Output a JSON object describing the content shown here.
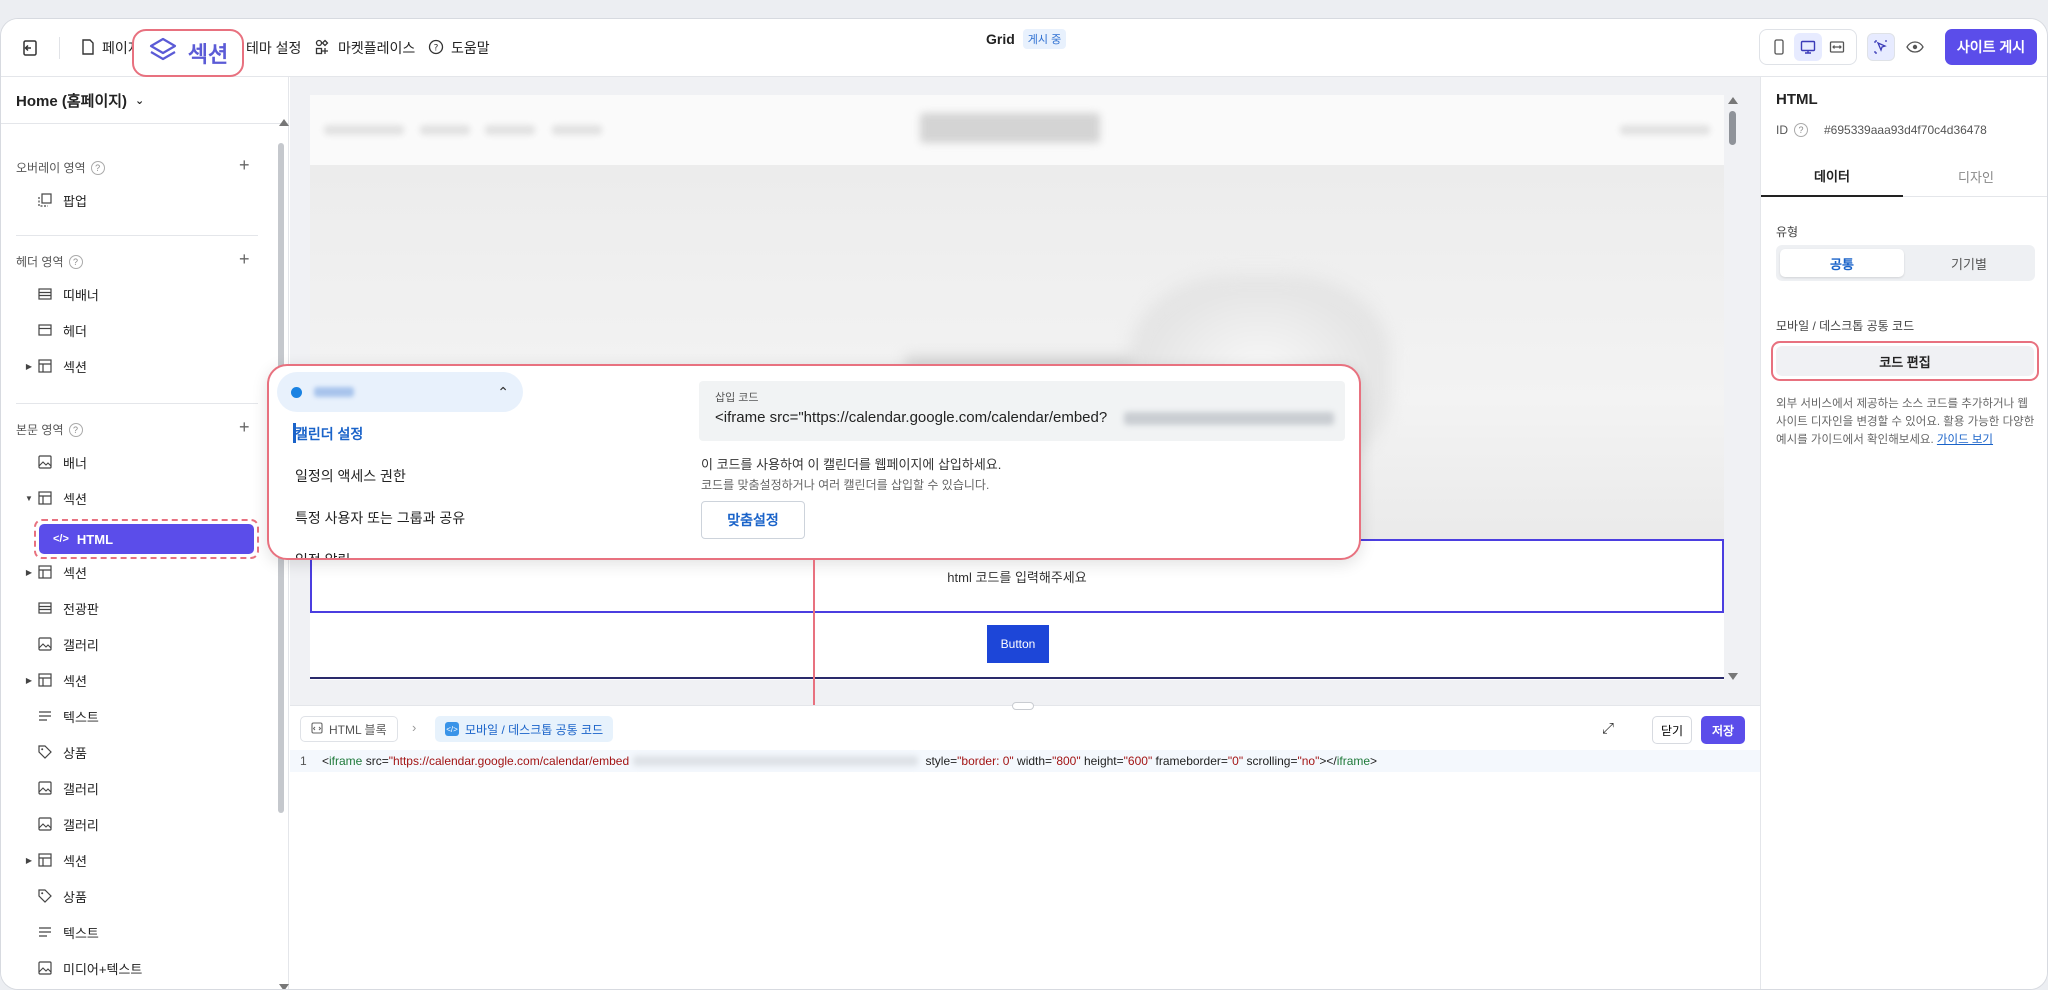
{
  "topbar": {
    "page_label": "페이지",
    "section_label": "섹션",
    "theme_label": "테마 설정",
    "marketplace_label": "마켓플레이스",
    "help_label": "도움말",
    "title": "Grid",
    "status_badge": "게시 중",
    "publish_label": "사이트 게시"
  },
  "left": {
    "page_selector": "Home (홈페이지)",
    "groups": {
      "overlay": "오버레이 영역",
      "header": "헤더 영역",
      "body": "본문 영역"
    },
    "items": {
      "popup": "팝업",
      "ddibanner": "띠배너",
      "header": "헤더",
      "section1": "섹션",
      "banner": "배너",
      "section2": "섹션",
      "html": "HTML",
      "section3": "섹션",
      "billboard": "전광판",
      "gallery1": "갤러리",
      "section4": "섹션",
      "text1": "텍스트",
      "product1": "상품",
      "gallery2": "갤러리",
      "gallery3": "갤러리",
      "section5": "섹션",
      "product2": "상품",
      "text2": "텍스트",
      "mediatext": "미디어+텍스트"
    }
  },
  "canvas": {
    "html_placeholder": "html 코드를 입력해주세요",
    "button_label": "Button"
  },
  "callout": {
    "menu": {
      "calendar_settings": "캘린더 설정",
      "access": "일정의 액세스 권한",
      "share": "특정 사용자 또는 그룹과 공유",
      "partial": "일정 알림"
    },
    "embed_label": "삽입 코드",
    "embed_code": "<iframe src=\"https://calendar.google.com/calendar/embed?",
    "desc1": "이 코드를 사용하여 이 캘린더를 웹페이지에 삽입하세요.",
    "desc2": "코드를 맞춤설정하거나 여러 캘린더를 삽입할 수 있습니다.",
    "custom_button": "맞춤설정"
  },
  "editor": {
    "crumb1": "HTML 블록",
    "crumb_sep": "›",
    "crumb2": "모바일 / 데스크톱 공통 코드",
    "close_label": "닫기",
    "save_label": "저장",
    "line_number": "1",
    "code": {
      "open_lt": "<",
      "tag": "iframe",
      "src_attr": " src=",
      "src_val": "\"https://calendar.google.com/calendar/embed",
      "style_attr": " style=",
      "style_val": "\"border: 0\"",
      "width_attr": " width=",
      "width_val": "\"800\"",
      "height_attr": " height=",
      "height_val": "\"600\"",
      "fb_attr": " frameborder=",
      "fb_val": "\"0\"",
      "scroll_attr": " scrolling=",
      "scroll_val": "\"no\"",
      "close": "></",
      "end": ">"
    }
  },
  "right": {
    "title": "HTML",
    "id_label": "ID",
    "id_value": "#695339aaa93d4f70c4d36478",
    "tab_data": "데이터",
    "tab_design": "디자인",
    "type_label": "유형",
    "seg_common": "공통",
    "seg_device": "기기별",
    "code_label": "모바일 / 데스크톱 공통 코드",
    "code_edit": "코드 편집",
    "help_text": "외부 서비스에서 제공하는 소스 코드를 추가하거나 웹사이트 디자인을 변경할 수 있어요. 활용 가능한 다양한 예시를 가이드에서 확인해보세요.",
    "guide_link": "가이드 보기"
  },
  "colors": {
    "accent": "#5b4dea",
    "highlight": "#e8717f",
    "link": "#1a63c9",
    "canvas_button": "#1d46d8"
  }
}
